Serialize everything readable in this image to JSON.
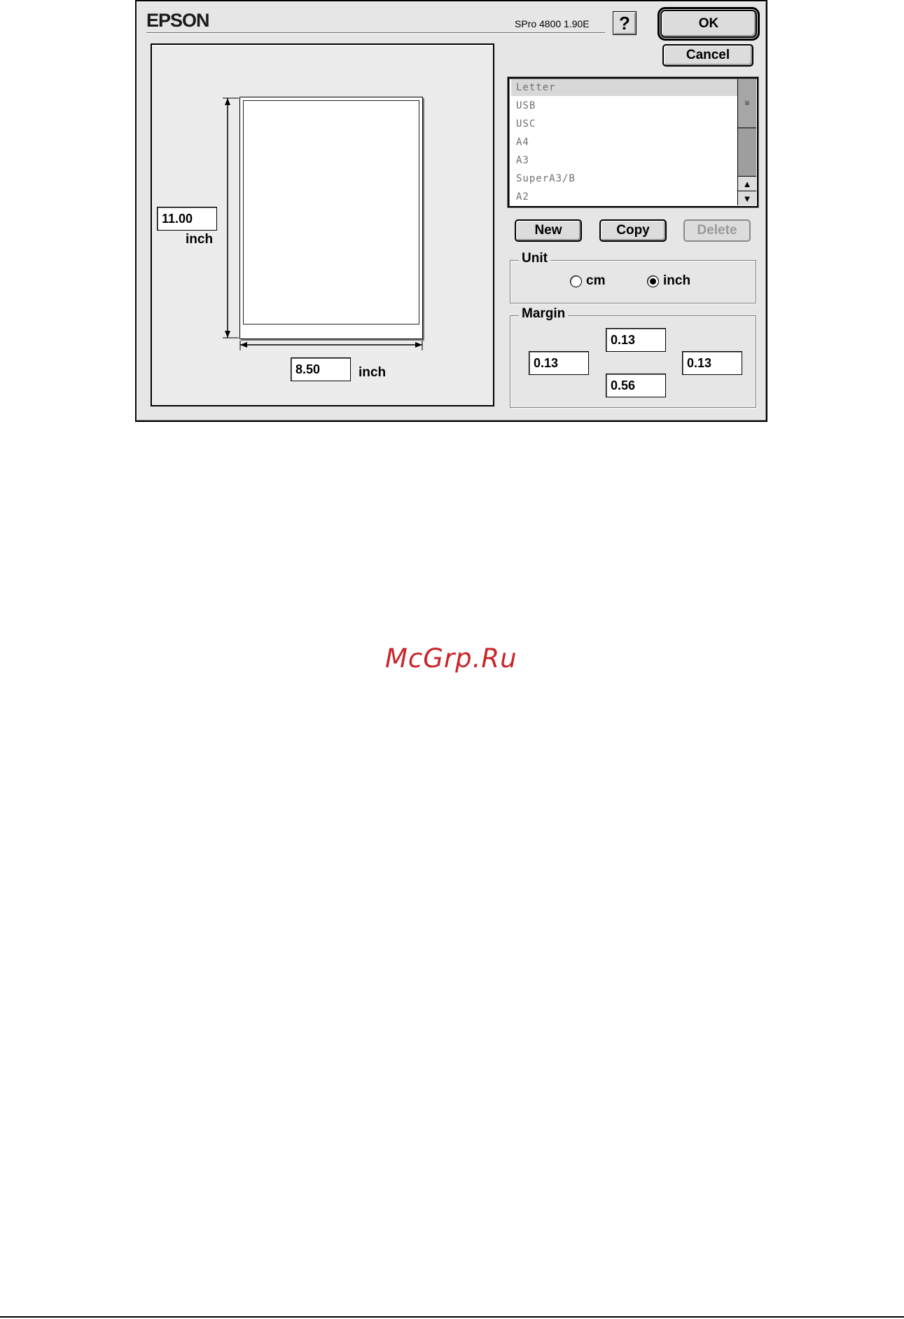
{
  "dialog": {
    "brand": "EPSON",
    "version": "SPro 4800 1.90E",
    "help_label": "?",
    "buttons": {
      "ok": "OK",
      "cancel": "Cancel",
      "new": "New",
      "copy": "Copy",
      "delete": "Delete"
    }
  },
  "preview": {
    "height_value": "11.00",
    "height_unit": "inch",
    "width_value": "8.50",
    "width_unit": "inch"
  },
  "paper_list": {
    "items": [
      "Letter",
      "USB",
      "USC",
      "A4",
      "A3",
      "SuperA3/B",
      "A2"
    ],
    "selected": "Letter"
  },
  "unit": {
    "title": "Unit",
    "options": [
      "cm",
      "inch"
    ],
    "selected": "inch"
  },
  "margin": {
    "title": "Margin",
    "top": "0.13",
    "left": "0.13",
    "right": "0.13",
    "bottom": "0.56"
  },
  "watermark": "McGrp.Ru",
  "colors": {
    "watermark": "#c8262b",
    "dialog_bg": "#e6e6e6"
  }
}
